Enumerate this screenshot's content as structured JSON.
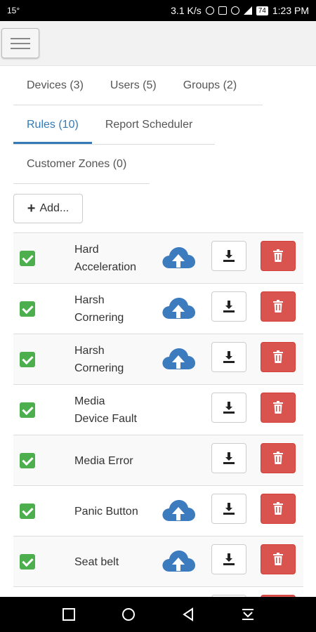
{
  "status_bar": {
    "left_text": "15°",
    "speed": "3.1 K/s",
    "battery": "74",
    "time": "1:23 PM"
  },
  "tabs_row1": [
    {
      "label": "Devices (3)"
    },
    {
      "label": "Users (5)"
    },
    {
      "label": "Groups (2)"
    }
  ],
  "tabs_row2": [
    {
      "label": "Rules (10)",
      "active": true
    },
    {
      "label": "Report Scheduler"
    }
  ],
  "tabs_row3": [
    {
      "label": "Customer Zones (0)"
    }
  ],
  "add_button": {
    "label": "Add..."
  },
  "rules": [
    {
      "name": "Hard\nAcceleration",
      "enabled": true,
      "cloud": true
    },
    {
      "name": "Harsh\nCornering",
      "enabled": true,
      "cloud": true
    },
    {
      "name": "Harsh\nCornering",
      "enabled": true,
      "cloud": true
    },
    {
      "name": "Media\nDevice Fault",
      "enabled": true,
      "cloud": false
    },
    {
      "name": "Media Error",
      "enabled": true,
      "cloud": false
    },
    {
      "name": "Panic Button",
      "enabled": true,
      "cloud": true
    },
    {
      "name": "Seat belt",
      "enabled": true,
      "cloud": true
    },
    {
      "name": "",
      "enabled": true,
      "cloud": false
    }
  ],
  "colors": {
    "accent": "#337ab7",
    "check_green": "#4cae4c",
    "danger_red": "#d9534f",
    "cloud_blue": "#3d7bbf"
  }
}
